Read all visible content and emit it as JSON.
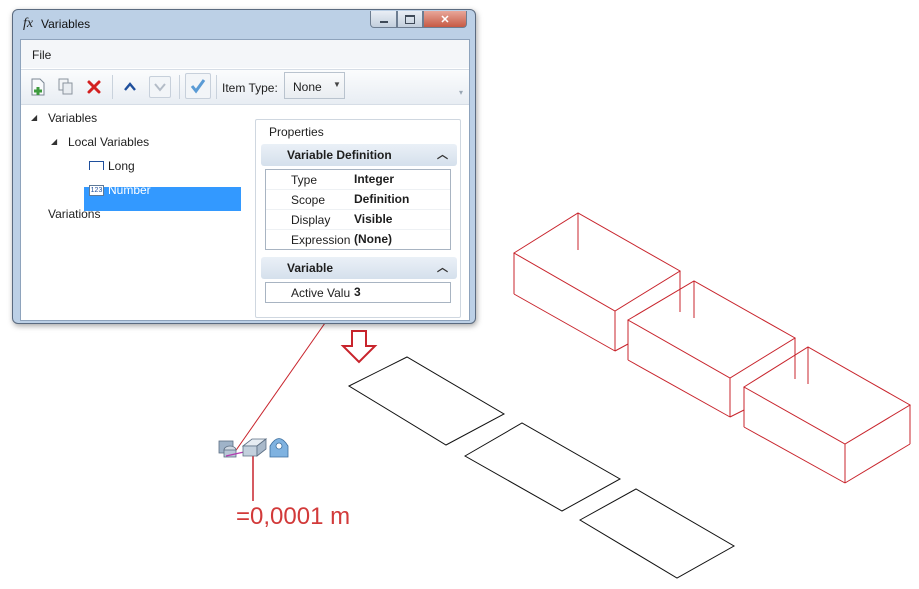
{
  "window": {
    "icon": "fx",
    "title": "Variables",
    "controls": [
      "minimize-icon",
      "maximize-icon",
      "close-icon"
    ]
  },
  "menu": {
    "file": "File"
  },
  "toolbar": {
    "buttons": [
      "new-variable-icon",
      "copy-icon",
      "delete-icon",
      "move-up-icon",
      "move-down-icon",
      "check-icon"
    ],
    "item_type_label": "Item Type:",
    "item_type_value": "None",
    "colors": {
      "delete": "#d32020",
      "arrow": "#1f4f9c",
      "check": "#5a9bd5"
    }
  },
  "tree": {
    "root": "Variables",
    "local": "Local Variables",
    "long": "Long",
    "number": "Number",
    "number_icon": "123",
    "variations": "Variations",
    "selected": "Number",
    "selected_color": "#3399ff"
  },
  "properties": {
    "title": "Properties",
    "section1": "Variable Definition",
    "rows1": [
      {
        "name": "Type",
        "value": "Integer"
      },
      {
        "name": "Scope",
        "value": "Definition"
      },
      {
        "name": "Display",
        "value": "Visible"
      },
      {
        "name": "Expression",
        "value": "(None)"
      }
    ],
    "section2": "Variable",
    "rows2": [
      {
        "name": "Active Valu",
        "value": "3"
      }
    ]
  },
  "annotation": {
    "dimension_text": "=0,0001 m",
    "color": "#d23a3a",
    "icons": [
      "parametric-solid-icon",
      "extrude-icon",
      "anchor-icon"
    ]
  }
}
